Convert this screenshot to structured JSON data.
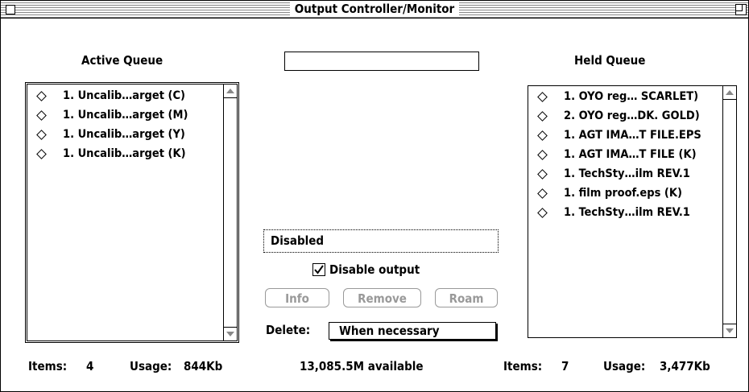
{
  "window": {
    "title": "Output Controller/Monitor"
  },
  "active_queue": {
    "label": "Active Queue",
    "items": [
      "1. Uncalib…arget (C)",
      "1. Uncalib…arget (M)",
      "1. Uncalib…arget (Y)",
      "1. Uncalib…arget (K)"
    ],
    "items_label": "Items:",
    "items_count": "4",
    "usage_label": "Usage:",
    "usage_value": "844Kb"
  },
  "held_queue": {
    "label": "Held Queue",
    "items": [
      "1. OYO reg… SCARLET)",
      "2. OYO reg…DK. GOLD)",
      "1. AGT IMA…T FILE.EPS",
      "1. AGT IMA…T FILE (K)",
      "1. TechSty…ilm REV.1",
      "1. film proof.eps (K)",
      "1. TechSty…ilm REV.1"
    ],
    "items_label": "Items:",
    "items_count": "7",
    "usage_label": "Usage:",
    "usage_value": "3,477Kb"
  },
  "center": {
    "name_field_value": "",
    "status_value": "Disabled",
    "disable_output_label": "Disable output",
    "disable_output_checked": true,
    "buttons": {
      "info": "Info",
      "remove": "Remove",
      "roam": "Roam"
    },
    "delete_label": "Delete:",
    "delete_value": "When necessary",
    "available_text": "13,085.5M available"
  },
  "icons": {
    "close": "close-box-icon",
    "zoom": "zoom-box-icon",
    "item": "diamond-icon",
    "scroll_up": "scroll-up-arrow-icon",
    "scroll_down": "scroll-down-arrow-icon",
    "check": "checkmark-icon"
  }
}
